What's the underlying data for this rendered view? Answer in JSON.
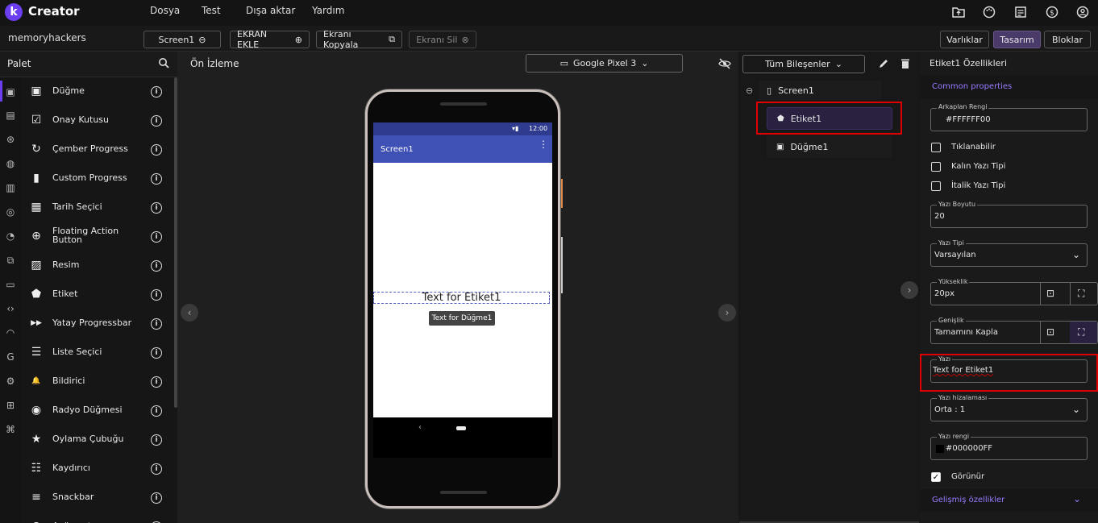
{
  "app": {
    "logo_letter": "k",
    "brand": "Creator"
  },
  "menu": {
    "items": [
      "Dosya",
      "Test",
      "Dışa aktar",
      "Yardım"
    ]
  },
  "top_icons": [
    "folder-upload-icon",
    "palette-icon",
    "list-icon",
    "dollar-icon",
    "account-icon"
  ],
  "project": {
    "name": "memoryhackers"
  },
  "toolbar": {
    "screen_select": "Screen1",
    "add_screen": "EKRAN EKLE",
    "copy_screen": "Ekranı Kopyala",
    "delete_screen": "Ekranı Sil"
  },
  "view_tabs": {
    "assets": "Varlıklar",
    "design": "Tasarım",
    "blocks": "Bloklar"
  },
  "palette": {
    "title": "Palet",
    "items": [
      {
        "label": "Düğme",
        "icon": "button-icon",
        "glyph": "▣"
      },
      {
        "label": "Onay Kutusu",
        "icon": "checkbox-icon",
        "glyph": "☑"
      },
      {
        "label": "Çember Progress",
        "icon": "refresh-icon",
        "glyph": "↻"
      },
      {
        "label": "Custom Progress",
        "icon": "bars-icon",
        "glyph": "▮"
      },
      {
        "label": "Tarih Seçici",
        "icon": "calendar-icon",
        "glyph": "▦"
      },
      {
        "label": "Floating Action",
        "label2": "Button",
        "icon": "add-circle-icon",
        "glyph": "⊕"
      },
      {
        "label": "Resim",
        "icon": "image-icon",
        "glyph": "▨"
      },
      {
        "label": "Etiket",
        "icon": "label-icon",
        "glyph": "⬟"
      },
      {
        "label": "Yatay Progressbar",
        "icon": "fast-forward-icon",
        "glyph": "▶▶"
      },
      {
        "label": "Liste Seçici",
        "icon": "checklist-icon",
        "glyph": "☰"
      },
      {
        "label": "Bildirici",
        "icon": "bell-icon",
        "glyph": "🔔"
      },
      {
        "label": "Radyo Düğmesi",
        "icon": "radio-icon",
        "glyph": "◉"
      },
      {
        "label": "Oylama Çubuğu",
        "icon": "star-icon",
        "glyph": "★"
      },
      {
        "label": "Kaydırıcı",
        "icon": "slider-icon",
        "glyph": "☷"
      },
      {
        "label": "Snackbar",
        "icon": "snackbar-icon",
        "glyph": "≡"
      },
      {
        "label": "Aç/kapat",
        "icon": "toggle-icon",
        "glyph": "●"
      }
    ]
  },
  "preview": {
    "title": "Ön İzleme",
    "device": "Google Pixel 3",
    "clock": "12:00",
    "screen_title": "Screen1",
    "label_text": "Text for Etiket1",
    "button_text": "Text for Düğme1"
  },
  "components": {
    "filter": "Tüm Bileşenler",
    "tree": [
      {
        "label": "Screen1",
        "icon": "phone-icon"
      },
      {
        "label": "Etiket1",
        "icon": "label-icon"
      },
      {
        "label": "Düğme1",
        "icon": "button-icon"
      }
    ]
  },
  "properties": {
    "title": "Etiket1 Özellikleri",
    "common": "Common properties",
    "bg_color_label": "Arkaplan Rengi",
    "bg_color": "#FFFFFF00",
    "clickable": "Tıklanabilir",
    "bold": "Kalın Yazı Tipi",
    "italic": "İtalik Yazı Tipi",
    "font_size_label": "Yazı Boyutu",
    "font_size": "20",
    "font_type_label": "Yazı Tipi",
    "font_type": "Varsayılan",
    "height_label": "Yükseklik",
    "height": "20px",
    "width_label": "Genişlik",
    "width": "Tamamını Kapla",
    "text_label": "Yazı",
    "text": "Text for Etiket1",
    "align_label": "Yazı hizalaması",
    "align": "Orta : 1",
    "text_color_label": "Yazı rengi",
    "text_color": "#000000FF",
    "visible": "Görünür",
    "advanced": "Gelişmiş özellikler"
  },
  "colors": {
    "accent": "#6b3ff0",
    "appbar": "#3f51b5",
    "highlight": "#e00000",
    "link": "#9b7bff"
  }
}
